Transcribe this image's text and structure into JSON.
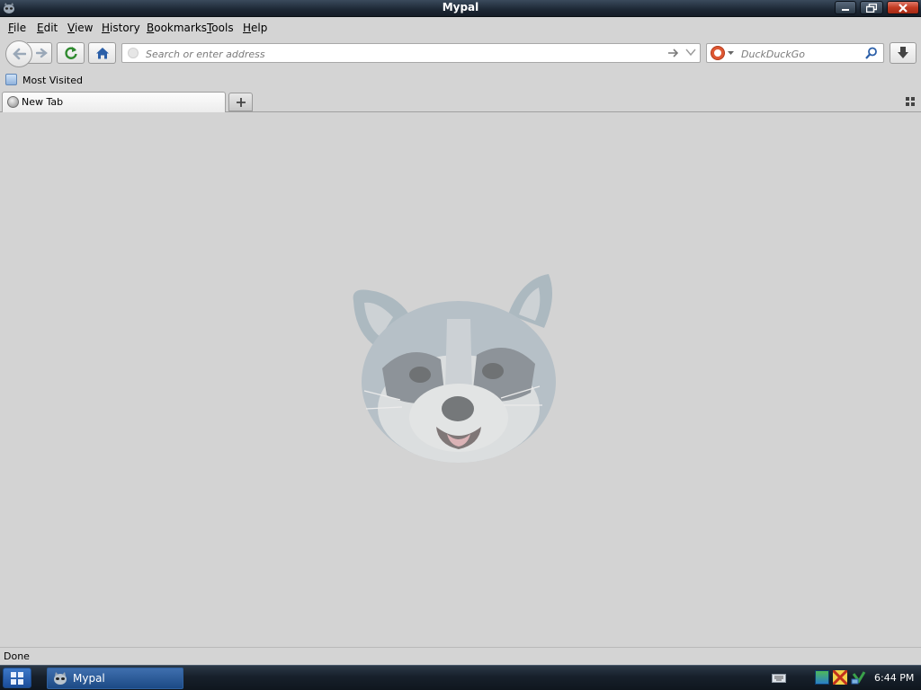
{
  "window": {
    "title": "Mypal"
  },
  "menu": {
    "items": [
      {
        "accel": "F",
        "rest": "ile"
      },
      {
        "accel": "E",
        "rest": "dit"
      },
      {
        "accel": "V",
        "rest": "iew"
      },
      {
        "accel": "H",
        "rest": "istory"
      },
      {
        "accel": "B",
        "rest": "ookmarks"
      },
      {
        "accel": "T",
        "rest": "ools"
      },
      {
        "accel": "H",
        "rest": "elp"
      }
    ]
  },
  "navbar": {
    "url_placeholder": "Search or enter address",
    "search_placeholder": "DuckDuckGo",
    "search_engine_icon": "duckduckgo-icon"
  },
  "bookmarks": {
    "most_visited": "Most Visited"
  },
  "tabs": [
    {
      "label": "New Tab",
      "active": true
    }
  ],
  "content": {
    "image": "raccoon-mascot"
  },
  "status": {
    "text": "Done"
  },
  "taskbar": {
    "task_label": "Mypal",
    "clock": "6:44 PM"
  },
  "colors": {
    "title_bar": "#1c2734",
    "close_button": "#c23a22",
    "taskbar_active": "#1c4a85",
    "chrome_bg": "#d4d4d4"
  }
}
